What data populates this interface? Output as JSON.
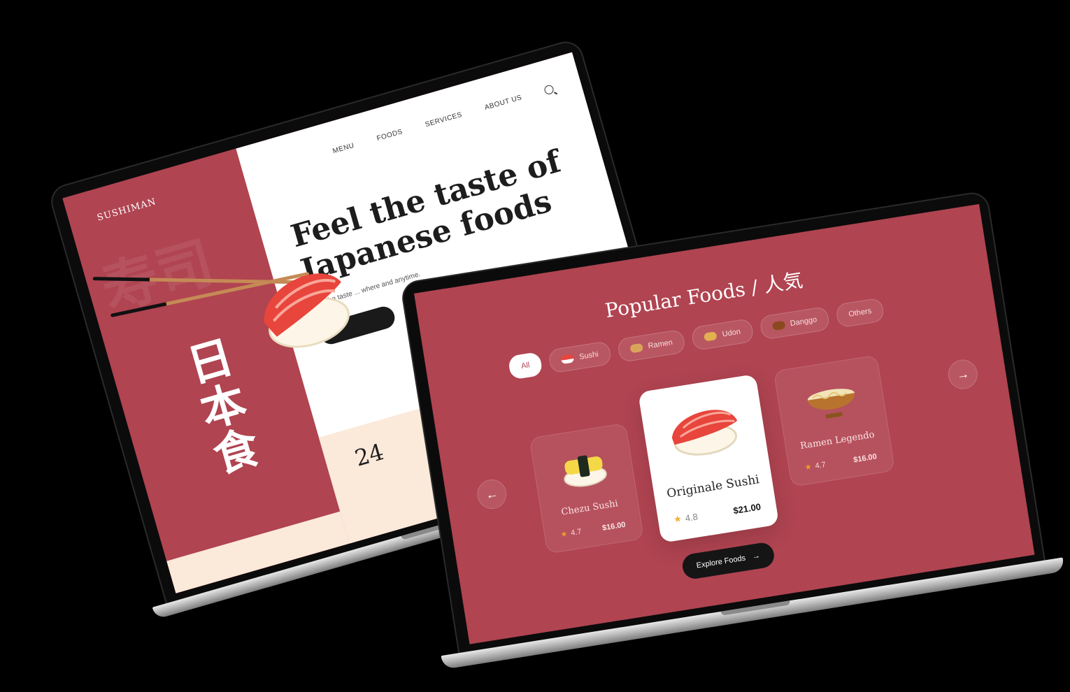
{
  "landing": {
    "brand": "SUSHIMAN",
    "nav": [
      "MENU",
      "FOODS",
      "SERVICES",
      "ABOUT US"
    ],
    "hero_title_line1": "Feel the taste of",
    "hero_title_line2": "Japanese foods",
    "hero_sub": "Feel the taste ... where and anytime.",
    "stat_partial": "24",
    "kanji": [
      "日",
      "本",
      "食"
    ],
    "faint_kanji": "寿司"
  },
  "popular": {
    "title": "Popular Foods / 人気",
    "chips": [
      {
        "label": "All",
        "active": true
      },
      {
        "label": "Sushi"
      },
      {
        "label": "Ramen"
      },
      {
        "label": "Udon"
      },
      {
        "label": "Danggo"
      },
      {
        "label": "Others"
      }
    ],
    "cards": [
      {
        "name": "Chezu Sushi",
        "rating": "4.7",
        "price": "$16.00"
      },
      {
        "name": "Originale Sushi",
        "rating": "4.8",
        "price": "$21.00"
      },
      {
        "name": "Ramen Legendo",
        "rating": "4.7",
        "price": "$16.00"
      }
    ],
    "prev_icon": "←",
    "next_icon": "→",
    "star_icon": "★",
    "explore_label": "Explore Foods",
    "explore_icon": "→"
  },
  "colors": {
    "brand_red": "#b04451",
    "beige": "#fbe9da",
    "dark": "#151515",
    "star": "#f2a91c"
  }
}
